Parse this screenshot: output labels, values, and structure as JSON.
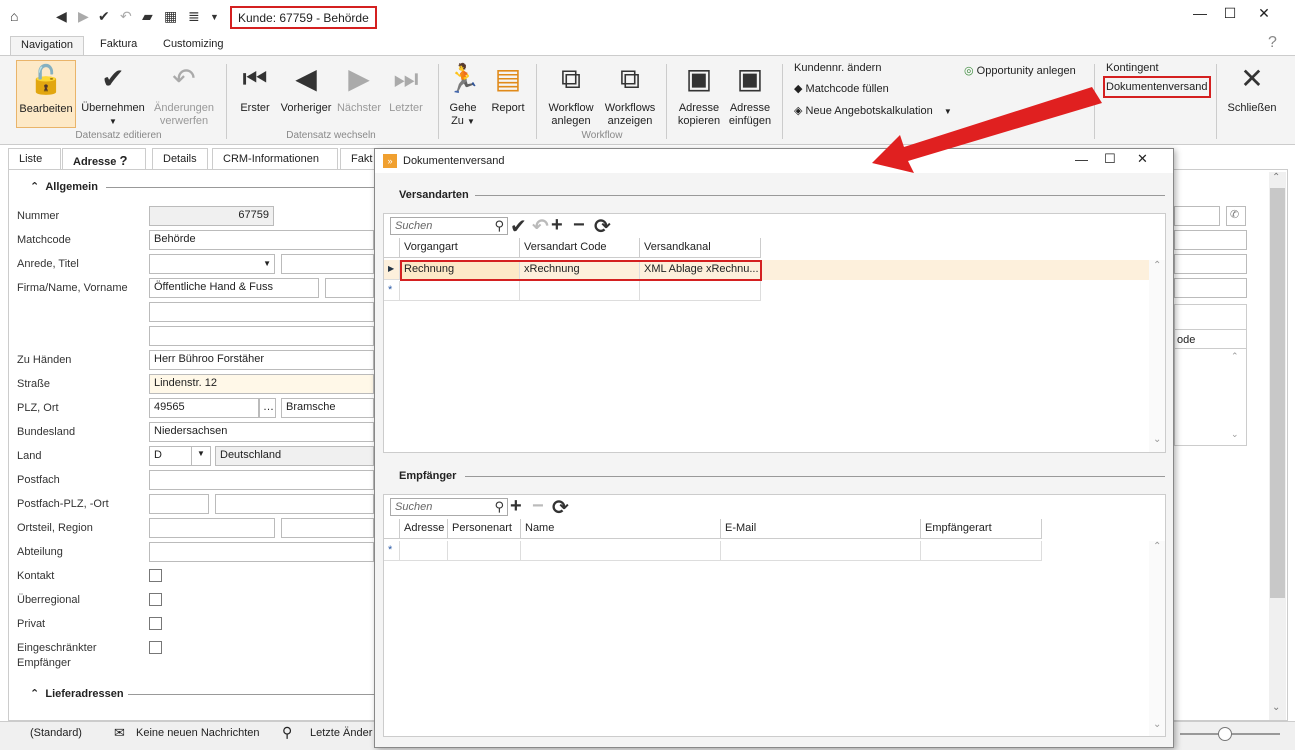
{
  "window": {
    "title": "Kunde: 67759 - Behörde"
  },
  "ribbon_tabs": [
    "Navigation",
    "Faktura",
    "Customizing"
  ],
  "ribbon": {
    "edit_buttons": {
      "bearbeiten": "Bearbeiten",
      "uebernehmen": "Übernehmen",
      "aenderungen_l1": "Änderungen",
      "aenderungen_l2": "verwerfen",
      "group": "Datensatz editieren"
    },
    "nav_buttons": {
      "erster": "Erster",
      "vorheriger": "Vorheriger",
      "naechster": "Nächster",
      "letzter": "Letzter",
      "group": "Datensatz wechseln"
    },
    "gehe_l1": "Gehe",
    "gehe_l2": "Zu",
    "report": "Report",
    "workflow_anlegen_l1": "Workflow",
    "workflow_anlegen_l2": "anlegen",
    "workflows_anzeigen_l1": "Workflows",
    "workflows_anzeigen_l2": "anzeigen",
    "workflow_group": "Workflow",
    "adresse_kopieren_l1": "Adresse",
    "adresse_kopieren_l2": "kopieren",
    "adresse_einfuegen_l1": "Adresse",
    "adresse_einfuegen_l2": "einfügen",
    "kundennr_aendern": "Kundennr. ändern",
    "matchcode_fuellen": "Matchcode füllen",
    "neue_angebotskalkulation": "Neue Angebotskalkulation",
    "opportunity_anlegen": "Opportunity anlegen",
    "kontingent": "Kontingent",
    "dokumentenversand": "Dokumentenversand",
    "schliessen": "Schließen"
  },
  "main_tabs": [
    "Liste",
    "Adresse",
    "Details",
    "CRM-Informationen",
    "Fakt"
  ],
  "form": {
    "section_allgemein": "Allgemein",
    "section_lieferadressen": "Lieferadressen",
    "labels": {
      "nummer": "Nummer",
      "matchcode": "Matchcode",
      "anrede": "Anrede, Titel",
      "firma": "Firma/Name, Vorname",
      "zu_haenden": "Zu Händen",
      "strasse": "Straße",
      "plz_ort": "PLZ, Ort",
      "bundesland": "Bundesland",
      "land": "Land",
      "postfach": "Postfach",
      "postfach_plz": "Postfach-PLZ, -Ort",
      "ortsteil": "Ortsteil, Region",
      "abteilung": "Abteilung",
      "kontakt": "Kontakt",
      "ueberregional": "Überregional",
      "privat": "Privat",
      "eingeschraenkt_l1": "Eingeschränkter",
      "eingeschraenkt_l2": "Empfänger"
    },
    "values": {
      "nummer": "67759",
      "matchcode": "Behörde",
      "firma": "Öffentliche Hand & Fuss",
      "zu_haenden": "Herr Bühroo Forstäher",
      "strasse": "Lindenstr. 12",
      "plz": "49565",
      "ort": "Bramsche",
      "bundesland": "Niedersachsen",
      "land_code": "D",
      "land": "Deutschland"
    },
    "partial_right_header": "ode"
  },
  "statusbar": {
    "standard": "(Standard)",
    "nachrichten": "Keine neuen Nachrichten",
    "letzte": "Letzte Änder"
  },
  "dialog": {
    "title": "Dokumentenversand",
    "versandarten": {
      "section": "Versandarten",
      "search_placeholder": "Suchen",
      "columns": [
        "Vorgangart",
        "Versandart Code",
        "Versandkanal"
      ],
      "rows": [
        [
          "Rechnung",
          "xRechnung",
          "XML Ablage xRechnu..."
        ]
      ]
    },
    "empfaenger": {
      "section": "Empfänger",
      "search_placeholder": "Suchen",
      "columns": [
        "Adresse",
        "Personenart",
        "Name",
        "E-Mail",
        "Empfängerart"
      ]
    }
  },
  "colors": {
    "highlight_red": "#d42020",
    "arrow_red": "#e02020",
    "selected_row": "#fde9c7"
  }
}
